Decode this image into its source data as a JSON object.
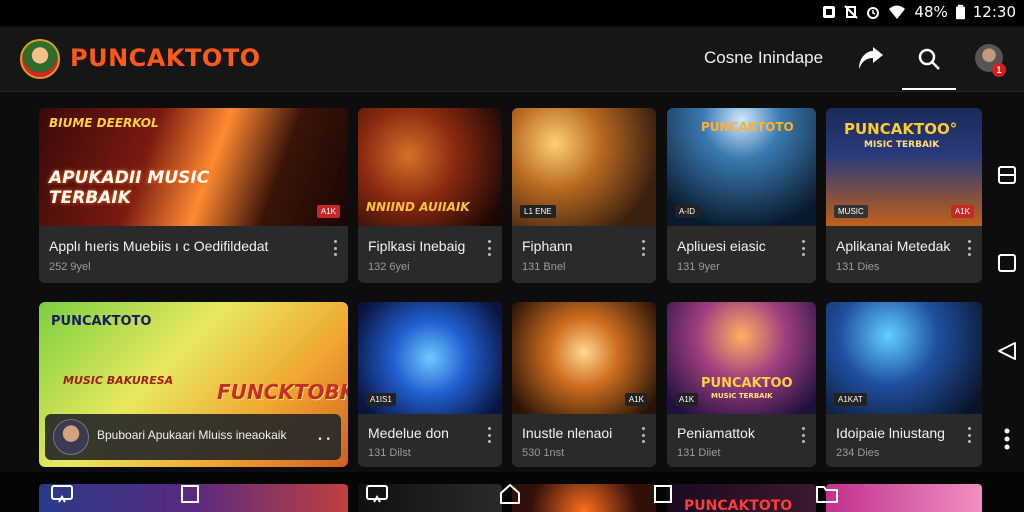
{
  "status_bar": {
    "battery": "48%",
    "time": "12:30",
    "icons": [
      "notification-icon",
      "silent-icon",
      "alarm-icon",
      "wifi-icon",
      "battery-icon"
    ]
  },
  "header": {
    "brand": "PUNCAKTOTO",
    "label": "Cosne Inindape",
    "icons": [
      "share-icon",
      "search-icon",
      "profile-avatar"
    ],
    "profile_badge": "1"
  },
  "row1": [
    {
      "title": "Applı hıeris Muebiis ı c Oedifildedat",
      "meta": "252 9yel",
      "thumb_top": "BIUME DEERKOL",
      "thumb_big": "APUKADII MUSIC TERBAIK",
      "badge": "A1K"
    },
    {
      "title": "Fiplkasi Inebaig",
      "meta": "132 6yei",
      "thumb_big": "NNIIND AUIIAIK"
    },
    {
      "title": "Fiphann",
      "meta": "131 Bnel",
      "badge_left": "L1 ENE"
    },
    {
      "title": "Apliuesi eiasic",
      "meta": "131 9yer",
      "thumb_top": "PUNCAKTOTO",
      "badge_left": "A-ID"
    },
    {
      "title": "Aplikanai Metedak",
      "meta": "131 Dies",
      "thumb_top": "PUNCAKTOO°",
      "thumb_sub": "MISIC TERBAIK",
      "badge": "A1K",
      "badge_2": "MUSIC"
    }
  ],
  "row2": [
    {
      "featured": true,
      "thumb_top": "PUNCAKTOTO",
      "thumb_left": "MUSIC BAKURESA",
      "thumb_big": "FUNCKTOBK",
      "overlay_text": "Bpuboari Apukaari Mluiss ineaokaik",
      "overlay_kebab": "• •"
    },
    {
      "title": "Medelue don",
      "meta": "131 Dilst",
      "badge_left": "A1IS1"
    },
    {
      "title": "Inustle nlenaoi",
      "meta": "530 1nst",
      "badge": "A1K"
    },
    {
      "title": "Peniamattok",
      "meta": "131 Diiet",
      "thumb_top": "PUNCAKTOO",
      "thumb_sub": "MUSIC TERBAIK",
      "badge_left": "A1K"
    },
    {
      "title": "Idoipaie lniustang",
      "meta": "234 Dies",
      "badge_left": "A1KAT"
    }
  ],
  "side_nav": [
    "recents-icon",
    "home-square-icon",
    "back-triangle-icon",
    "more-dots-icon"
  ],
  "bottom": {
    "brand": "PUNCAKTOTO",
    "icons": [
      "cast-icon",
      "square-icon",
      "cast-icon",
      "home-icon",
      "square-icon",
      "folder-icon"
    ]
  },
  "colors": {
    "brand": "#ff5a1a",
    "card_bg": "#2a2a2a",
    "bg": "#0d0d0d",
    "badge_red": "#c62828"
  }
}
